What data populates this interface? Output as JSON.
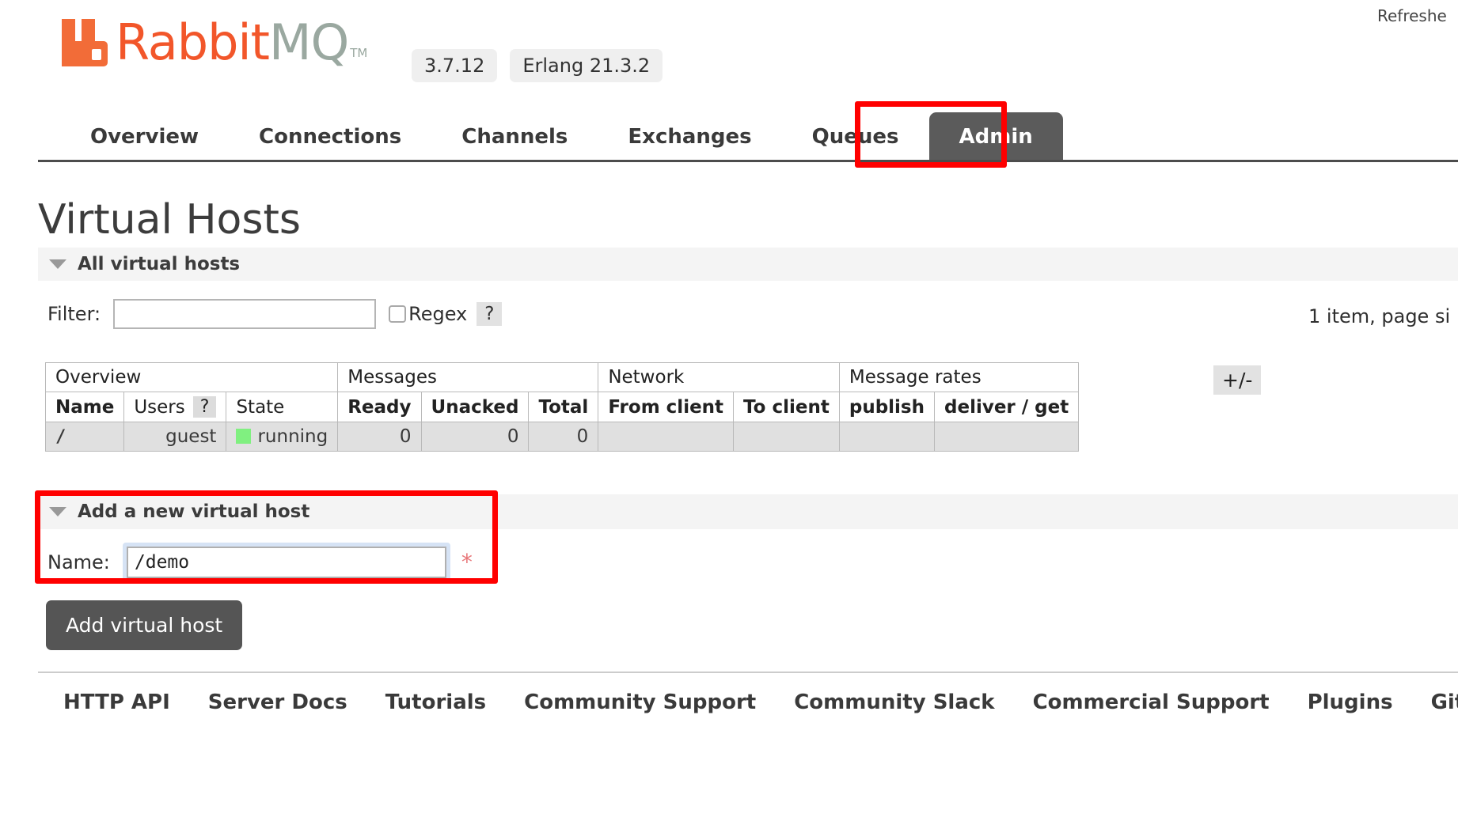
{
  "header": {
    "refresh_status": "Refreshe",
    "logo_text_primary": "Rabbit",
    "logo_text_secondary": "MQ",
    "logo_trademark": "TM",
    "version_badge": "3.7.12",
    "erlang_badge": "Erlang 21.3.2"
  },
  "nav": {
    "items": [
      {
        "label": "Overview",
        "active": false
      },
      {
        "label": "Connections",
        "active": false
      },
      {
        "label": "Channels",
        "active": false
      },
      {
        "label": "Exchanges",
        "active": false
      },
      {
        "label": "Queues",
        "active": false
      },
      {
        "label": "Admin",
        "active": true
      }
    ]
  },
  "page": {
    "title": "Virtual Hosts"
  },
  "all_vhosts": {
    "section_label": "All virtual hosts",
    "filter_label": "Filter:",
    "filter_value": "",
    "filter_placeholder": "",
    "regex_label": "Regex",
    "regex_help": "?",
    "regex_checked": false,
    "paging_info": "1 item, page si",
    "plus_minus": "+/-"
  },
  "table": {
    "group_headers": [
      {
        "label": "Overview",
        "span": 3
      },
      {
        "label": "Messages",
        "span": 3
      },
      {
        "label": "Network",
        "span": 2
      },
      {
        "label": "Message rates",
        "span": 2
      }
    ],
    "columns": [
      {
        "label": "Name",
        "bold": true
      },
      {
        "label": "Users",
        "bold": false,
        "help": "?"
      },
      {
        "label": "State",
        "bold": false
      },
      {
        "label": "Ready",
        "bold": true
      },
      {
        "label": "Unacked",
        "bold": true
      },
      {
        "label": "Total",
        "bold": true
      },
      {
        "label": "From client",
        "bold": true
      },
      {
        "label": "To client",
        "bold": true
      },
      {
        "label": "publish",
        "bold": true
      },
      {
        "label": "deliver / get",
        "bold": true
      }
    ],
    "rows": [
      {
        "name": "/",
        "users": "guest",
        "state": "running",
        "state_color": "#80f080",
        "ready": "0",
        "unacked": "0",
        "total": "0",
        "from_client": "",
        "to_client": "",
        "publish": "",
        "deliver_get": ""
      }
    ]
  },
  "add_vhost": {
    "section_label": "Add a new virtual host",
    "name_label": "Name:",
    "name_value": "/demo",
    "required_marker": "*",
    "submit_label": "Add virtual host"
  },
  "footer": {
    "links": [
      "HTTP API",
      "Server Docs",
      "Tutorials",
      "Community Support",
      "Community Slack",
      "Commercial Support",
      "Plugins",
      "GitHub"
    ]
  },
  "colors": {
    "brand_orange": "#f2562a",
    "logo_gray": "#9aa8a0",
    "active_tab": "#5b5b5b",
    "annotation_red": "#ff0000",
    "running_green": "#80f080"
  }
}
